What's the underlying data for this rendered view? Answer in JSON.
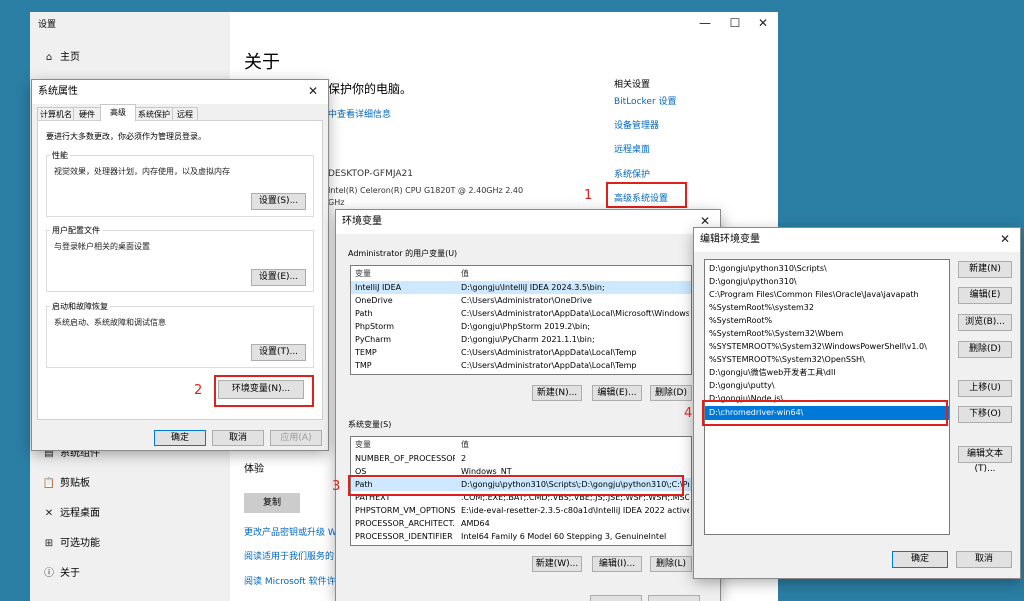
{
  "settings": {
    "title": "设置",
    "nav": {
      "home": "主页",
      "items": [
        "系统组件",
        "剪贴板",
        "远程桌面",
        "可选功能",
        "关于"
      ]
    },
    "page_title": "关于",
    "protect_text": "保护你的电脑。",
    "details_link": "中查看详细信息",
    "device_name": "DESKTOP-GFMJA21",
    "processor": "Intel(R) Celeron(R) CPU G1820T @ 2.40GHz   2.40",
    "processor_unit": "GHz",
    "experience_label": "体验",
    "copy_button": "复制",
    "links": [
      "更改产品密钥或升级 W",
      "阅读适用于我们服务的",
      "阅读 Microsoft 软件许可"
    ],
    "related": {
      "title": "相关设置",
      "links": [
        "BitLocker 设置",
        "设备管理器",
        "远程桌面",
        "系统保护",
        "高级系统设置"
      ]
    }
  },
  "sysprops": {
    "title": "系统属性",
    "tabs": [
      "计算机名",
      "硬件",
      "高级",
      "系统保护",
      "远程"
    ],
    "active_tab": "高级",
    "admin_note": "要进行大多数更改，你必须作为管理员登录。",
    "performance": {
      "label": "性能",
      "desc": "视觉效果，处理器计划，内存使用，以及虚拟内存",
      "button": "设置(S)..."
    },
    "profile": {
      "label": "用户配置文件",
      "desc": "与登录帐户相关的桌面设置",
      "button": "设置(E)..."
    },
    "startup": {
      "label": "启动和故障恢复",
      "desc": "系统启动、系统故障和调试信息",
      "button": "设置(T)..."
    },
    "env_button": "环境变量(N)...",
    "ok": "确定",
    "cancel": "取消",
    "apply": "应用(A)"
  },
  "envvars": {
    "title": "环境变量",
    "user_section": "Administrator 的用户变量(U)",
    "col_var": "变量",
    "col_val": "值",
    "user_vars": [
      {
        "name": "IntelliJ IDEA",
        "value": "D:\\gongju\\IntelliJ IDEA 2024.3.5\\bin;"
      },
      {
        "name": "OneDrive",
        "value": "C:\\Users\\Administrator\\OneDrive"
      },
      {
        "name": "Path",
        "value": "C:\\Users\\Administrator\\AppData\\Local\\Microsoft\\WindowsA..."
      },
      {
        "name": "PhpStorm",
        "value": "D:\\gongju\\PhpStorm 2019.2\\bin;"
      },
      {
        "name": "PyCharm",
        "value": "D:\\gongju\\PyCharm 2021.1.1\\bin;"
      },
      {
        "name": "TEMP",
        "value": "C:\\Users\\Administrator\\AppData\\Local\\Temp"
      },
      {
        "name": "TMP",
        "value": "C:\\Users\\Administrator\\AppData\\Local\\Temp"
      }
    ],
    "user_buttons": [
      "新建(N)...",
      "编辑(E)...",
      "删除(D)"
    ],
    "sys_section": "系统变量(S)",
    "sys_vars": [
      {
        "name": "NUMBER_OF_PROCESSORS",
        "value": "2"
      },
      {
        "name": "OS",
        "value": "Windows_NT"
      },
      {
        "name": "Path",
        "value": "D:\\gongju\\python310\\Scripts\\;D:\\gongju\\python310\\;C:\\Prog..."
      },
      {
        "name": "PATHEXT",
        "value": ".COM;.EXE;.BAT;.CMD;.VBS;.VBE;.JS;.JSE;.WSF;.WSH;.MSC;.PY;.P..."
      },
      {
        "name": "PHPSTORM_VM_OPTIONS",
        "value": "E:\\ide-eval-resetter-2.3.5-c80a1d\\IntelliJ IDEA 2022 active\\jet..."
      },
      {
        "name": "PROCESSOR_ARCHITECT...",
        "value": "AMD64"
      },
      {
        "name": "PROCESSOR_IDENTIFIER",
        "value": "Intel64 Family 6 Model 60 Stepping 3, GenuineIntel"
      }
    ],
    "sys_buttons": [
      "新建(W)...",
      "编辑(I)...",
      "删除(L)"
    ]
  },
  "editenv": {
    "title": "编辑环境变量",
    "entries": [
      "D:\\gongju\\python310\\Scripts\\",
      "D:\\gongju\\python310\\",
      "C:\\Program Files\\Common Files\\Oracle\\Java\\javapath",
      "%SystemRoot%\\system32",
      "%SystemRoot%",
      "%SystemRoot%\\System32\\Wbem",
      "%SYSTEMROOT%\\System32\\WindowsPowerShell\\v1.0\\",
      "%SYSTEMROOT%\\System32\\OpenSSH\\",
      "D:\\gongju\\微信web开发者工具\\dll",
      "D:\\gongju\\putty\\",
      "D:\\gongju\\Node.js\\",
      "D:\\chromedriver-win64\\"
    ],
    "selected": "D:\\chromedriver-win64\\",
    "buttons": [
      "新建(N)",
      "编辑(E)",
      "浏览(B)...",
      "删除(D)",
      "上移(U)",
      "下移(O)",
      "编辑文本(T)..."
    ],
    "ok": "确定",
    "cancel": "取消"
  },
  "annotations": [
    "1",
    "2",
    "3",
    "4"
  ],
  "colors": {
    "desktop": "#2b7ea4",
    "annotation_red": "#e0201b",
    "link_blue": "#0067c0",
    "selection_blue": "#0078d7"
  }
}
